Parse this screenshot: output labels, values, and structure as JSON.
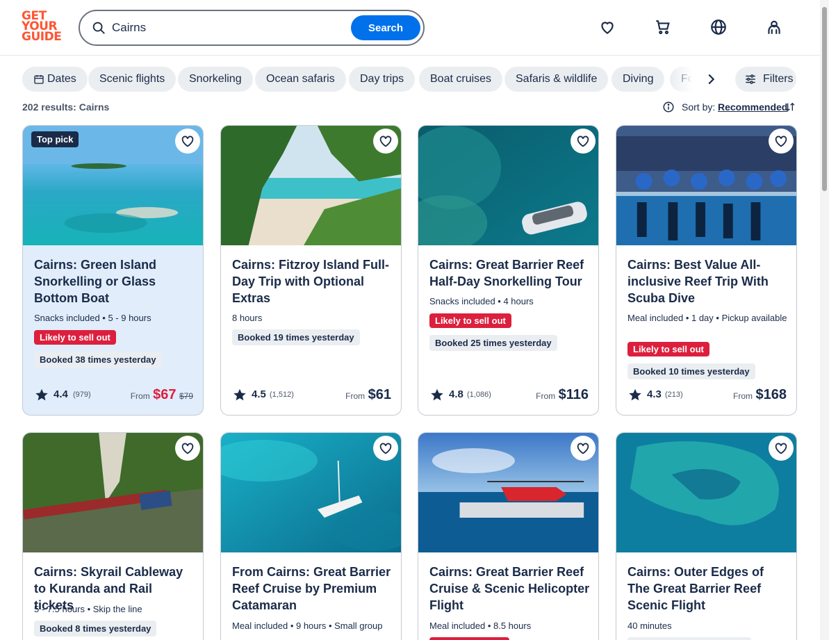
{
  "logo": {
    "line1": "GET",
    "line2": "YOUR",
    "line3": "GUIDE"
  },
  "search": {
    "value": "Cairns",
    "button": "Search"
  },
  "chips": [
    {
      "label": "Dates"
    },
    {
      "label": "Scenic flights"
    },
    {
      "label": "Snorkeling"
    },
    {
      "label": "Ocean safaris"
    },
    {
      "label": "Day trips"
    },
    {
      "label": "Boat cruises"
    },
    {
      "label": "Safaris & wildlife"
    },
    {
      "label": "Diving"
    },
    {
      "label": "Fo"
    }
  ],
  "filters_label": "Filters",
  "results_text": "202 results: Cairns",
  "sort": {
    "label": "Sort by:",
    "value": "Recommended"
  },
  "colors": {
    "brand": "#ff5533",
    "primary": "#0071eb",
    "sale": "#dc1f3d",
    "navy": "#1a2b49"
  },
  "cards": [
    {
      "top_pick": "Top pick",
      "title": "Cairns: Green Island Snorkelling or Glass Bottom Boat",
      "meta": "Snacks included • 5 - 9 hours",
      "red_badge": "Likely to sell out",
      "booked": "Booked 38 times yesterday",
      "rating": "4.4",
      "reviews": "(979)",
      "from": "From",
      "price": "$67",
      "old_price": "$79"
    },
    {
      "title": "Cairns: Fitzroy Island Full-Day Trip with Optional Extras",
      "meta": "8 hours",
      "booked": "Booked 19 times yesterday",
      "rating": "4.5",
      "reviews": "(1,512)",
      "from": "From",
      "price": "$61"
    },
    {
      "title": "Cairns: Great Barrier Reef Half-Day Snorkelling Tour",
      "meta": "Snacks included • 4 hours",
      "red_badge": "Likely to sell out",
      "booked": "Booked 25 times yesterday",
      "rating": "4.8",
      "reviews": "(1,086)",
      "from": "From",
      "price": "$116"
    },
    {
      "title": "Cairns: Best Value All-inclusive Reef Trip With Scuba Dive",
      "meta": "Meal included • 1 day • Pickup available",
      "red_badge": "Likely to sell out",
      "booked": "Booked 10 times yesterday",
      "rating": "4.3",
      "reviews": "(213)",
      "from": "From",
      "price": "$168"
    },
    {
      "title": "Cairns: Skyrail Cableway to Kuranda and Rail tickets",
      "meta": "5 - 7.5 hours • Skip the line",
      "booked": "Booked 8 times yesterday"
    },
    {
      "title": "From Cairns: Great Barrier Reef Cruise by Premium Catamaran",
      "meta": "Meal included • 9 hours • Small group"
    },
    {
      "title": "Cairns: Great Barrier Reef Cruise & Scenic Helicopter Flight",
      "meta": "Meal included • 8.5 hours"
    },
    {
      "title": "Cairns: Outer Edges of The Great Barrier Reef Scenic Flight",
      "meta": "40 minutes"
    }
  ]
}
